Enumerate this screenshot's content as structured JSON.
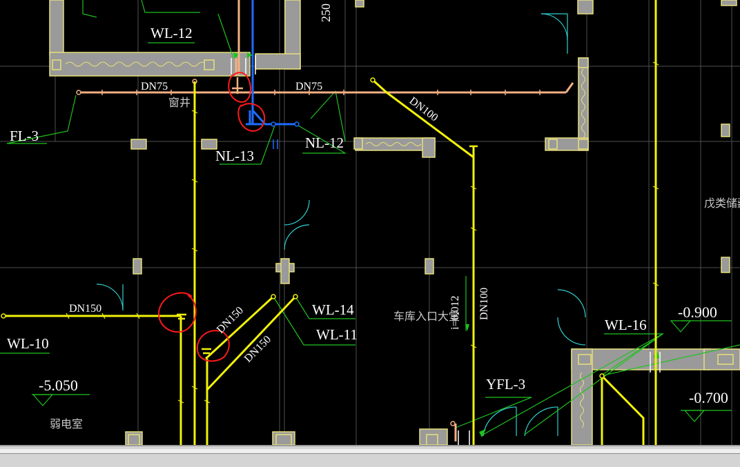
{
  "colors": {
    "background": "#000000",
    "wall_fill": "#9a9a9a",
    "wall_edge": "#e8e07a",
    "grid": "#505050",
    "pipe_yellow": "#f2f20a",
    "pipe_orange": "#f4b183",
    "pipe_blue": "#1e6cff",
    "leader_green": "#1fc21f",
    "door_cyan": "#2fd0d0",
    "annotation_red": "#ff1a1a"
  },
  "labels": {
    "wl_12": "WL-12",
    "fl_3": "FL-3",
    "nl_13": "NL-13",
    "nl_12": "NL-12",
    "wl_10": "WL-10",
    "wl_14": "WL-14",
    "wl_11": "WL-11",
    "wl_16": "WL-16",
    "yfl_3": "YFL-3",
    "dn75_left": "DN75",
    "dn75_right": "DN75",
    "dn100_diag": "DN100",
    "dn100_vert": "DN100",
    "dn150_left": "DN150",
    "dn150_diag_a": "DN150",
    "dn150_diag_b": "DN150",
    "slope": "i=0.012",
    "dim_250": "250",
    "elev_5050": "-5.050",
    "elev_0900": "-0.900",
    "elev_0700": "-0.700",
    "room_window_shaft": "窗井",
    "room_weak_current": "弱电室",
    "room_garage_entry": "车库入口大堂",
    "room_storage": "戊类储藏"
  }
}
